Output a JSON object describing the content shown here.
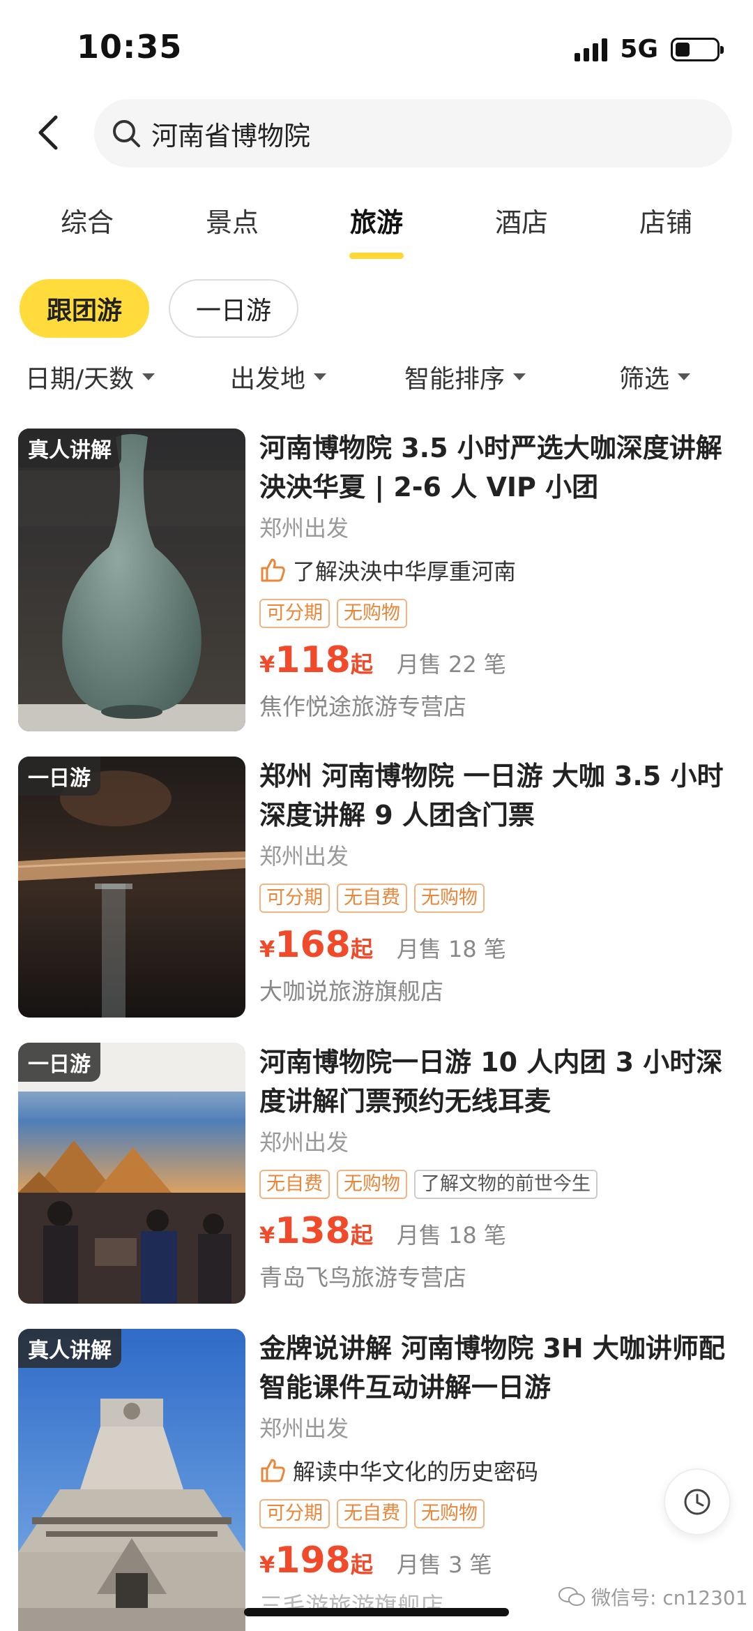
{
  "status_bar": {
    "time": "10:35",
    "network": "5G",
    "battery_level": 0.35
  },
  "search": {
    "query": "河南省博物院"
  },
  "tabs": [
    {
      "label": "综合",
      "active": false
    },
    {
      "label": "景点",
      "active": false
    },
    {
      "label": "旅游",
      "active": true
    },
    {
      "label": "酒店",
      "active": false
    },
    {
      "label": "店铺",
      "active": false
    }
  ],
  "chips": [
    {
      "label": "跟团游",
      "selected": true
    },
    {
      "label": "一日游",
      "selected": false
    }
  ],
  "filters": [
    {
      "label": "日期/天数"
    },
    {
      "label": "出发地"
    },
    {
      "label": "智能排序"
    },
    {
      "label": "筛选"
    }
  ],
  "products": [
    {
      "badge": "真人讲解",
      "title": "河南博物院 3.5 小时严选大咖深度讲解泱泱华夏 | 2-6 人 VIP 小团",
      "depart": "郑州出发",
      "highlight": "了解泱泱中华厚重河南",
      "tags": [
        "可分期",
        "无购物"
      ],
      "currency": "¥",
      "price": "118",
      "price_suffix": "起",
      "sales": "月售 22 笔",
      "shop": "焦作悦途旅游专营店"
    },
    {
      "badge": "一日游",
      "title": "郑州 河南博物院 一日游 大咖 3.5 小时深度讲解 9 人团含门票",
      "depart": "郑州出发",
      "highlight": "",
      "tags": [
        "可分期",
        "无自费",
        "无购物"
      ],
      "currency": "¥",
      "price": "168",
      "price_suffix": "起",
      "sales": "月售 18 笔",
      "shop": "大咖说旅游旗舰店"
    },
    {
      "badge": "一日游",
      "title": "河南博物院一日游 10 人内团 3 小时深度讲解门票预约无线耳麦",
      "depart": "郑州出发",
      "highlight": "",
      "tags": [
        "无自费",
        "无购物"
      ],
      "tag_extra": "了解文物的前世今生",
      "currency": "¥",
      "price": "138",
      "price_suffix": "起",
      "sales": "月售 18 笔",
      "shop": "青岛飞鸟旅游专营店"
    },
    {
      "badge": "真人讲解",
      "title": "金牌说讲解 河南博物院 3H 大咖讲师配智能课件互动讲解一日游",
      "depart": "郑州出发",
      "highlight": "解读中华文化的历史密码",
      "tags": [
        "可分期",
        "无自费",
        "无购物"
      ],
      "currency": "¥",
      "price": "198",
      "price_suffix": "起",
      "sales": "月售 3 笔",
      "shop": "三毛游旅游旗舰店"
    }
  ],
  "watermark": "微信号: cn12301",
  "colors": {
    "accent_yellow": "#ffdc3c",
    "price_red": "#f04a2a",
    "tag_orange": "#e8863a"
  }
}
